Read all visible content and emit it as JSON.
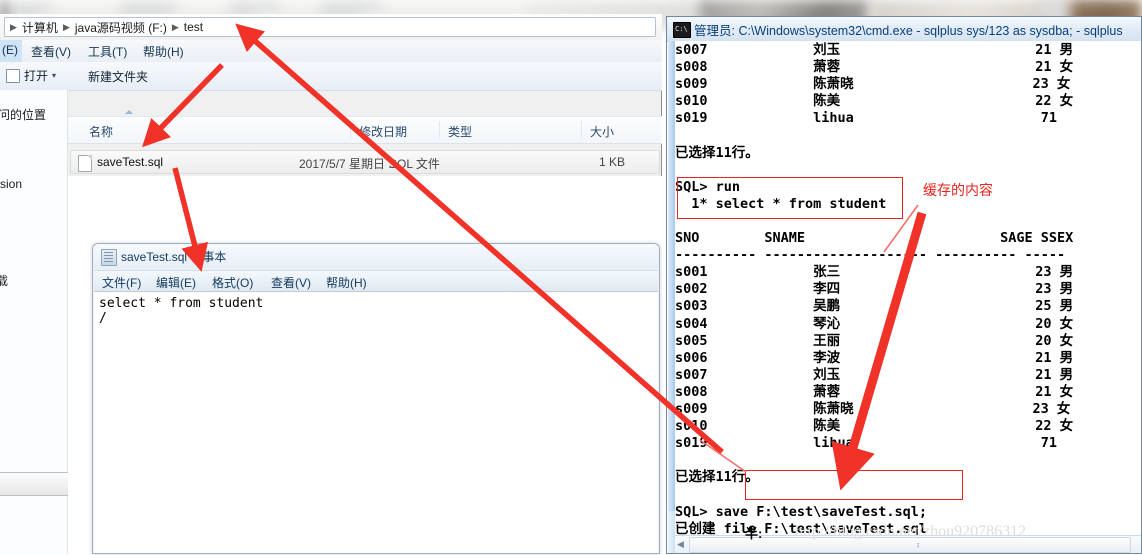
{
  "desktop": {
    "note": "blurred background photo strip at top of screen"
  },
  "explorer": {
    "breadcrumb": {
      "leading_arrow": "▶",
      "items": [
        "计算机",
        "java源码视频 (F:)",
        "test"
      ],
      "separator": "▶"
    },
    "menubar": [
      {
        "label": "(E)"
      },
      {
        "label": "查看(V)"
      },
      {
        "label": "工具(T)"
      },
      {
        "label": "帮助(H)"
      }
    ],
    "toolbar": {
      "open_label": "打开",
      "open_caret": "▾",
      "new_folder_label": "新建文件夹"
    },
    "nav_pane_fragments": [
      {
        "text": "问的位置"
      },
      {
        "text": "rsion"
      },
      {
        "text": "载"
      }
    ],
    "columns": [
      "名称",
      "修改日期",
      "类型",
      "大小"
    ],
    "rows": [
      {
        "name": "saveTest.sql",
        "modified": "2017/5/7 星期日 ...",
        "type": "SQL 文件",
        "size": "1 KB"
      }
    ]
  },
  "notepad": {
    "title": "saveTest.sql  记事本",
    "menubar": [
      {
        "label": "文件(F)"
      },
      {
        "label": "编辑(E)"
      },
      {
        "label": "格式(O)"
      },
      {
        "label": "查看(V)"
      },
      {
        "label": "帮助(H)"
      }
    ],
    "content": "select * from student\n/"
  },
  "cmd": {
    "title": "管理员: C:\\Windows\\system32\\cmd.exe - sqlplus  sys/123 as sysdba; - sqlplus",
    "console_text": "s007             刘玉                        21 男\ns008             萧蓉                        21 女\ns009             陈萧晓                      23 女\ns010             陈美                        22 女\ns019             lihua                       71\n\n已选择11行。\n\nSQL> run\n  1* select * from student\n\nSNO        SNAME                        SAGE SSEX\n---------- -------------------- ---------- -----\ns001             张三                        23 男\ns002             李四                        23 男\ns003             吴鹏                        25 男\ns004             琴沁                        20 女\ns005             王丽                        20 女\ns006             李波                        21 男\ns007             刘玉                        21 男\ns008             萧蓉                        21 女\ns009             陈萧晓                      23 女\ns010             陈美                        22 女\ns019             lihua                       71\n\n已选择11行。\n\nSQL> save F:\\test\\saveTest.sql;\n已创建 file F:\\test\\saveTest.sql\nSQL>",
    "half_text": "半:",
    "watermark": "http://blog.csdn.net/zhou920786312",
    "hscroll": {
      "left_arrow": "◀",
      "grip": "⠆"
    }
  },
  "annotations": {
    "accent_color": "#e8241f",
    "labels": [
      {
        "text": "缓存的内容"
      }
    ],
    "boxes": [
      {
        "name": "run-cache-box"
      },
      {
        "name": "save-path-box"
      }
    ],
    "arrows": [
      {
        "name": "arrow-to-breadcrumb"
      },
      {
        "name": "arrow-to-filename"
      },
      {
        "name": "arrow-to-notepad-menu"
      },
      {
        "name": "arrow-to-save-command"
      }
    ]
  }
}
